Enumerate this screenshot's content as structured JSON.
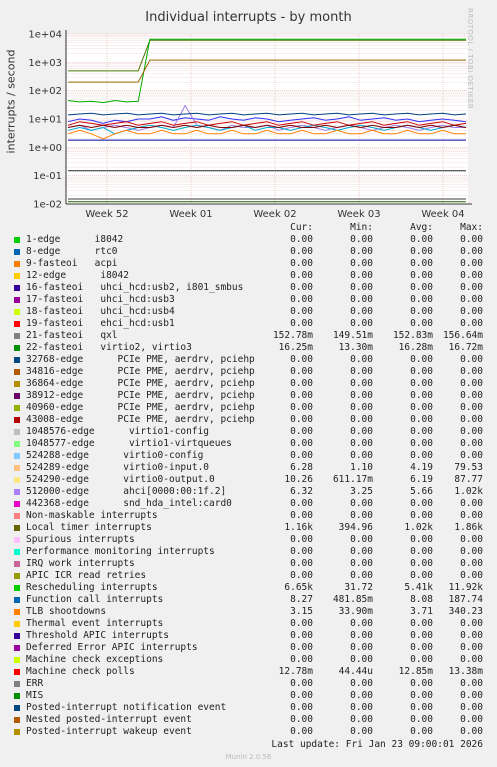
{
  "chart_data": {
    "type": "line",
    "title": "Individual interrupts - by month",
    "ylabel": "interrupts / second",
    "yscale": "log",
    "ylim": [
      0.01,
      10000
    ],
    "y_ticks": [
      "1e-02",
      "1e-01",
      "1e+00",
      "1e+01",
      "1e+02",
      "1e+03",
      "1e+04"
    ],
    "x_ticks": [
      "Week 52",
      "Week 01",
      "Week 02",
      "Week 03",
      "Week 04"
    ],
    "grid": true,
    "series": [
      {
        "name": "Local timer interrupts",
        "color": "#4a7a00",
        "values": [
          500,
          500,
          500,
          500,
          500,
          500,
          500,
          6000,
          6000,
          6000,
          6000,
          6000,
          6000,
          6000,
          6000,
          6000,
          6000,
          6000,
          6000,
          6000,
          6000,
          6000,
          6000,
          6000,
          6000,
          6000,
          6000,
          6000,
          6000,
          6000,
          6000,
          6000,
          6000,
          6000,
          6000
        ]
      },
      {
        "name": "21-fasteoi qxl",
        "color": "#00aa00",
        "values": [
          45,
          40,
          42,
          38,
          45,
          40,
          42,
          6500,
          6500,
          6500,
          6500,
          6500,
          6500,
          6500,
          6500,
          6500,
          6500,
          6500,
          6500,
          6500,
          6500,
          6500,
          6500,
          6500,
          6500,
          6500,
          6500,
          6500,
          6500,
          6500,
          6500,
          6500,
          6500,
          6500,
          6500
        ]
      },
      {
        "name": "Machine check polls",
        "color": "#996600",
        "values": [
          200,
          200,
          200,
          200,
          200,
          200,
          200,
          1200,
          1200,
          1200,
          1200,
          1200,
          1200,
          1200,
          1200,
          1200,
          1200,
          1200,
          1200,
          1200,
          1200,
          1200,
          1200,
          1200,
          1200,
          1200,
          1200,
          1200,
          1200,
          1200,
          1200,
          1200,
          1200,
          1200,
          1200
        ]
      },
      {
        "name": "Rescheduling interrupts",
        "color": "#3030ff",
        "values": [
          8,
          10,
          9,
          7,
          9,
          8,
          10,
          10,
          12,
          9,
          11,
          10,
          9,
          12,
          10,
          9,
          11,
          10,
          8,
          9,
          10,
          11,
          9,
          10,
          12,
          9,
          10,
          11,
          9,
          10,
          8,
          9,
          10,
          9,
          8
        ]
      },
      {
        "name": "512000-edge ahci[0000:00:1f.2]",
        "color": "#a07ae8",
        "values": [
          5,
          6,
          4,
          5,
          6,
          5,
          4,
          5,
          6,
          5,
          30,
          6,
          5,
          4,
          6,
          5,
          5,
          6,
          4,
          5,
          6,
          5,
          4,
          5,
          6,
          5,
          4,
          5,
          6,
          5,
          4,
          5,
          6,
          5,
          5
        ]
      },
      {
        "name": "Function call interrupts",
        "color": "#00aacc",
        "values": [
          4,
          5,
          4,
          5,
          3,
          4,
          5,
          6,
          5,
          4,
          5,
          6,
          5,
          4,
          5,
          6,
          4,
          5,
          5,
          4,
          5,
          6,
          5,
          4,
          5,
          6,
          5,
          4,
          5,
          6,
          5,
          4,
          5,
          6,
          5
        ]
      },
      {
        "name": "TLB shootdowns",
        "color": "#ff8000",
        "values": [
          3,
          4,
          3,
          2,
          3,
          4,
          3,
          3,
          4,
          3,
          3,
          4,
          3,
          3,
          4,
          3,
          3,
          4,
          3,
          3,
          4,
          3,
          3,
          4,
          3,
          3,
          4,
          3,
          3,
          4,
          3,
          3,
          4,
          3,
          3
        ]
      },
      {
        "name": "524290-edge virtio0-output.0",
        "color": "#cc0000",
        "values": [
          6,
          8,
          7,
          6,
          7,
          8,
          6,
          7,
          8,
          6,
          7,
          8,
          6,
          7,
          8,
          6,
          7,
          8,
          6,
          7,
          8,
          6,
          7,
          8,
          6,
          7,
          8,
          6,
          7,
          8,
          6,
          7,
          8,
          6,
          7
        ]
      },
      {
        "name": "524289-edge virtio0-input.0",
        "color": "#7f0000",
        "values": [
          5,
          6,
          5,
          6,
          5,
          6,
          5,
          5,
          6,
          5,
          6,
          5,
          6,
          5,
          5,
          6,
          5,
          6,
          5,
          6,
          5,
          5,
          6,
          5,
          6,
          5,
          6,
          5,
          5,
          6,
          5,
          6,
          5,
          6,
          5
        ]
      },
      {
        "name": "22-fasteoi virtio2, virtio3",
        "color": "#004080",
        "values": [
          14,
          15,
          16,
          14,
          15,
          16,
          14,
          15,
          16,
          14,
          15,
          16,
          14,
          15,
          16,
          14,
          15,
          16,
          14,
          15,
          16,
          14,
          15,
          16,
          14,
          15,
          16,
          14,
          15,
          16,
          14,
          15,
          16,
          14,
          15
        ]
      },
      {
        "name": "Thermal event interrupts",
        "color": "#2a2a2a",
        "values": [
          0.15,
          0.15,
          0.15,
          0.15,
          0.15,
          0.15,
          0.15,
          0.15,
          0.15,
          0.15,
          0.15,
          0.15,
          0.15,
          0.15,
          0.15,
          0.15,
          0.15,
          0.15,
          0.15,
          0.15,
          0.15,
          0.15,
          0.15,
          0.15,
          0.15,
          0.15,
          0.15,
          0.15,
          0.15,
          0.15,
          0.15,
          0.15,
          0.15,
          0.15,
          0.15
        ]
      },
      {
        "name": "16-fasteoi uhci_hcd:usb2, i801_smbus",
        "color": "#0000aa",
        "values": [
          1.8,
          1.8,
          1.8,
          1.8,
          1.8,
          1.8,
          1.8,
          1.8,
          1.8,
          1.8,
          1.8,
          1.8,
          1.8,
          1.8,
          1.8,
          1.8,
          1.8,
          1.8,
          1.8,
          1.8,
          1.8,
          1.8,
          1.8,
          1.8,
          1.8,
          1.8,
          1.8,
          1.8,
          1.8,
          1.8,
          1.8,
          1.8,
          1.8,
          1.8,
          1.8
        ]
      },
      {
        "name": "ERR",
        "color": "#3d3d3d",
        "values": [
          0.015,
          0.015,
          0.015,
          0.015,
          0.015,
          0.015,
          0.015,
          0.015,
          0.015,
          0.015,
          0.015,
          0.015,
          0.015,
          0.015,
          0.015,
          0.015,
          0.015,
          0.015,
          0.015,
          0.015,
          0.015,
          0.015,
          0.015,
          0.015,
          0.015,
          0.015,
          0.015,
          0.015,
          0.015,
          0.015,
          0.015,
          0.015,
          0.015,
          0.015,
          0.015
        ]
      },
      {
        "name": "MIS",
        "color": "#226600",
        "values": [
          0.012,
          0.012,
          0.012,
          0.012,
          0.012,
          0.012,
          0.012,
          0.012,
          0.012,
          0.012,
          0.012,
          0.012,
          0.012,
          0.012,
          0.012,
          0.012,
          0.012,
          0.012,
          0.012,
          0.012,
          0.012,
          0.012,
          0.012,
          0.012,
          0.012,
          0.012,
          0.012,
          0.012,
          0.012,
          0.012,
          0.012,
          0.012,
          0.012,
          0.012,
          0.012
        ]
      }
    ]
  },
  "side_label": "RRDTOOL / TOBI OETIKER",
  "legend": {
    "headers": [
      "Cur:",
      "Min:",
      "Avg:",
      "Max:"
    ],
    "rows": [
      {
        "color": "#00cc00",
        "label": "1-edge      i8042",
        "cur": "0.00",
        "min": "0.00",
        "avg": "0.00",
        "max": "0.00"
      },
      {
        "color": "#0066b3",
        "label": "8-edge      rtc0",
        "cur": "0.00",
        "min": "0.00",
        "avg": "0.00",
        "max": "0.00"
      },
      {
        "color": "#ff8000",
        "label": "9-fasteoi   acpi",
        "cur": "0.00",
        "min": "0.00",
        "avg": "0.00",
        "max": "0.00"
      },
      {
        "color": "#ffcc00",
        "label": "12-edge      i8042",
        "cur": "0.00",
        "min": "0.00",
        "avg": "0.00",
        "max": "0.00"
      },
      {
        "color": "#330099",
        "label": "16-fasteoi   uhci_hcd:usb2, i801_smbus",
        "cur": "0.00",
        "min": "0.00",
        "avg": "0.00",
        "max": "0.00"
      },
      {
        "color": "#990099",
        "label": "17-fasteoi   uhci_hcd:usb3",
        "cur": "0.00",
        "min": "0.00",
        "avg": "0.00",
        "max": "0.00"
      },
      {
        "color": "#ccff00",
        "label": "18-fasteoi   uhci_hcd:usb4",
        "cur": "0.00",
        "min": "0.00",
        "avg": "0.00",
        "max": "0.00"
      },
      {
        "color": "#ff0000",
        "label": "19-fasteoi   ehci_hcd:usb1",
        "cur": "0.00",
        "min": "0.00",
        "avg": "0.00",
        "max": "0.00"
      },
      {
        "color": "#808080",
        "label": "21-fasteoi   qxl",
        "cur": "152.78m",
        "min": "149.51m",
        "avg": "152.83m",
        "max": "156.64m"
      },
      {
        "color": "#008f00",
        "label": "22-fasteoi   virtio2, virtio3",
        "cur": "16.25m",
        "min": "13.30m",
        "avg": "16.28m",
        "max": "16.72m"
      },
      {
        "color": "#00487d",
        "label": "32768-edge      PCIe PME, aerdrv, pciehp",
        "cur": "0.00",
        "min": "0.00",
        "avg": "0.00",
        "max": "0.00"
      },
      {
        "color": "#b35a00",
        "label": "34816-edge      PCIe PME, aerdrv, pciehp",
        "cur": "0.00",
        "min": "0.00",
        "avg": "0.00",
        "max": "0.00"
      },
      {
        "color": "#b38f00",
        "label": "36864-edge      PCIe PME, aerdrv, pciehp",
        "cur": "0.00",
        "min": "0.00",
        "avg": "0.00",
        "max": "0.00"
      },
      {
        "color": "#6b006b",
        "label": "38912-edge      PCIe PME, aerdrv, pciehp",
        "cur": "0.00",
        "min": "0.00",
        "avg": "0.00",
        "max": "0.00"
      },
      {
        "color": "#8fb300",
        "label": "40960-edge      PCIe PME, aerdrv, pciehp",
        "cur": "0.00",
        "min": "0.00",
        "avg": "0.00",
        "max": "0.00"
      },
      {
        "color": "#b30000",
        "label": "43008-edge      PCIe PME, aerdrv, pciehp",
        "cur": "0.00",
        "min": "0.00",
        "avg": "0.00",
        "max": "0.00"
      },
      {
        "color": "#bebebe",
        "label": "1048576-edge      virtio1-config",
        "cur": "0.00",
        "min": "0.00",
        "avg": "0.00",
        "max": "0.00"
      },
      {
        "color": "#80ff80",
        "label": "1048577-edge      virtio1-virtqueues",
        "cur": "0.00",
        "min": "0.00",
        "avg": "0.00",
        "max": "0.00"
      },
      {
        "color": "#80c9ff",
        "label": "524288-edge      virtio0-config",
        "cur": "0.00",
        "min": "0.00",
        "avg": "0.00",
        "max": "0.00"
      },
      {
        "color": "#ffc080",
        "label": "524289-edge      virtio0-input.0",
        "cur": "6.28",
        "min": "1.10",
        "avg": "4.19",
        "max": "79.53"
      },
      {
        "color": "#ffe680",
        "label": "524290-edge      virtio0-output.0",
        "cur": "10.26",
        "min": "611.17m",
        "avg": "6.19",
        "max": "87.77"
      },
      {
        "color": "#aa80ff",
        "label": "512000-edge      ahci[0000:00:1f.2]",
        "cur": "6.32",
        "min": "3.25",
        "avg": "5.66",
        "max": "1.02k"
      },
      {
        "color": "#ee00cc",
        "label": "442368-edge      snd_hda_intel:card0",
        "cur": "0.00",
        "min": "0.00",
        "avg": "0.00",
        "max": "0.00"
      },
      {
        "color": "#ff8080",
        "label": "Non-maskable interrupts",
        "cur": "0.00",
        "min": "0.00",
        "avg": "0.00",
        "max": "0.00"
      },
      {
        "color": "#666600",
        "label": "Local timer interrupts",
        "cur": "1.16k",
        "min": "394.96",
        "avg": "1.02k",
        "max": "1.86k"
      },
      {
        "color": "#ffbfff",
        "label": "Spurious interrupts",
        "cur": "0.00",
        "min": "0.00",
        "avg": "0.00",
        "max": "0.00"
      },
      {
        "color": "#00ffcc",
        "label": "Performance monitoring interrupts",
        "cur": "0.00",
        "min": "0.00",
        "avg": "0.00",
        "max": "0.00"
      },
      {
        "color": "#cc6699",
        "label": "IRQ work interrupts",
        "cur": "0.00",
        "min": "0.00",
        "avg": "0.00",
        "max": "0.00"
      },
      {
        "color": "#999900",
        "label": "APIC ICR read retries",
        "cur": "0.00",
        "min": "0.00",
        "avg": "0.00",
        "max": "0.00"
      },
      {
        "color": "#00cc00",
        "label": "Rescheduling interrupts",
        "cur": "6.65k",
        "min": "31.72",
        "avg": "5.41k",
        "max": "11.92k"
      },
      {
        "color": "#0066b3",
        "label": "Function call interrupts",
        "cur": "8.27",
        "min": "481.85m",
        "avg": "8.08",
        "max": "187.74"
      },
      {
        "color": "#ff8000",
        "label": "TLB shootdowns",
        "cur": "3.15",
        "min": "33.90m",
        "avg": "3.71",
        "max": "340.23"
      },
      {
        "color": "#ffcc00",
        "label": "Thermal event interrupts",
        "cur": "0.00",
        "min": "0.00",
        "avg": "0.00",
        "max": "0.00"
      },
      {
        "color": "#330099",
        "label": "Threshold APIC interrupts",
        "cur": "0.00",
        "min": "0.00",
        "avg": "0.00",
        "max": "0.00"
      },
      {
        "color": "#990099",
        "label": "Deferred Error APIC interrupts",
        "cur": "0.00",
        "min": "0.00",
        "avg": "0.00",
        "max": "0.00"
      },
      {
        "color": "#ccff00",
        "label": "Machine check exceptions",
        "cur": "0.00",
        "min": "0.00",
        "avg": "0.00",
        "max": "0.00"
      },
      {
        "color": "#ff0000",
        "label": "Machine check polls",
        "cur": "12.78m",
        "min": "44.44u",
        "avg": "12.85m",
        "max": "13.38m"
      },
      {
        "color": "#808080",
        "label": "ERR",
        "cur": "0.00",
        "min": "0.00",
        "avg": "0.00",
        "max": "0.00"
      },
      {
        "color": "#008f00",
        "label": "MIS",
        "cur": "0.00",
        "min": "0.00",
        "avg": "0.00",
        "max": "0.00"
      },
      {
        "color": "#00487d",
        "label": "Posted-interrupt notification event",
        "cur": "0.00",
        "min": "0.00",
        "avg": "0.00",
        "max": "0.00"
      },
      {
        "color": "#b35a00",
        "label": "Nested posted-interrupt event",
        "cur": "0.00",
        "min": "0.00",
        "avg": "0.00",
        "max": "0.00"
      },
      {
        "color": "#b38f00",
        "label": "Posted-interrupt wakeup event",
        "cur": "0.00",
        "min": "0.00",
        "avg": "0.00",
        "max": "0.00"
      }
    ]
  },
  "last_update": "Last update: Fri Jan 23 09:00:01 2026",
  "footer": "Munin 2.0.56"
}
